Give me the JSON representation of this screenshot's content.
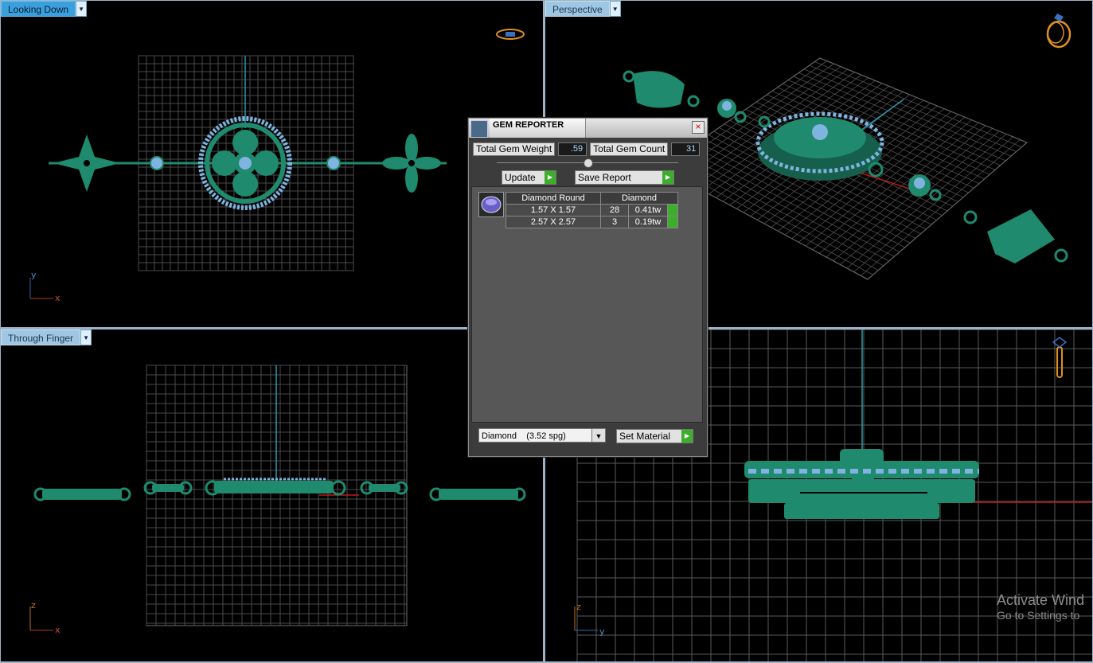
{
  "viewports": {
    "top_left": {
      "label": "Looking Down",
      "axis": [
        "y",
        "x"
      ]
    },
    "top_right": {
      "label": "Perspective"
    },
    "bottom_left": {
      "label": "Through Finger",
      "axis": [
        "z",
        "x"
      ]
    },
    "bottom_right": {
      "axis": [
        "z",
        "y"
      ]
    }
  },
  "dialog": {
    "title": "GEM REPORTER",
    "total_weight_label": "Total Gem Weight",
    "total_weight_value": ".59",
    "total_count_label": "Total Gem Count",
    "total_count_value": "31",
    "update_label": "Update",
    "save_label": "Save Report",
    "table": {
      "headers": [
        "Diamond Round",
        "Diamond"
      ],
      "rows": [
        {
          "size": "1.57 X 1.57",
          "count": "28",
          "weight": "0.41tw"
        },
        {
          "size": "2.57 X 2.57",
          "count": "3",
          "weight": "0.19tw"
        }
      ]
    },
    "material_value": "Diamond    (3.52 spg)",
    "set_material_label": "Set Material"
  },
  "watermark": {
    "line1": "Activate Wind",
    "line2": "Go to Settings to"
  },
  "colors": {
    "metal": "#1f8a6e",
    "gem": "#7fb4e0",
    "grid": "#5a5a5a"
  }
}
